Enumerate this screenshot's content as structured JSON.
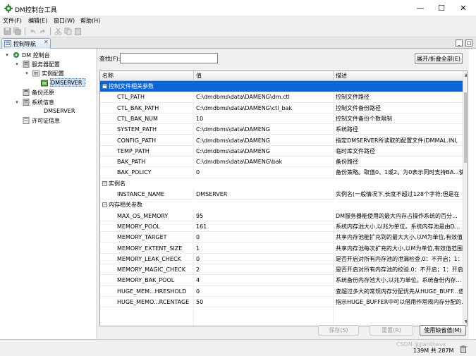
{
  "window": {
    "title": "DM控制台工具",
    "minimize": "—",
    "maximize": "☐",
    "close": "✕"
  },
  "menu": [
    "文件(F)",
    "编辑(E)",
    "窗口(W)",
    "帮助(H)"
  ],
  "tab": {
    "label": "控制导航",
    "close": "✕"
  },
  "tree": {
    "root": "DM 控制台",
    "server_config": "服务器配置",
    "instance_config": "实例配置",
    "dmserver_1": "DMSERVER",
    "backup": "备份还原",
    "sysinfo": "系统信息",
    "dmserver_2": "DMSERVER",
    "license": "许可证信息"
  },
  "search": {
    "label": "查找(F):",
    "value": ""
  },
  "expand_all": "展开/折叠全部(E)",
  "grid": {
    "headers": {
      "name": "名称",
      "value": "值",
      "desc": "描述"
    },
    "groups": [
      {
        "title": "控制文件相关参数",
        "expander": "−",
        "rows": [
          {
            "name": "CTL_PATH",
            "value": "C:\\dmdbms\\data\\DAMENG\\dm.ctl",
            "desc": "控制文件路径"
          },
          {
            "name": "CTL_BAK_PATH",
            "value": "C:\\dmdbms\\data\\DAMENG\\ctl_bak",
            "desc": "控制文件备份路径"
          },
          {
            "name": "CTL_BAK_NUM",
            "value": "10",
            "desc": "控制文件备份个数限制"
          },
          {
            "name": "SYSTEM_PATH",
            "value": "C:\\dmdbms\\data\\DAMENG",
            "desc": "系统路径"
          },
          {
            "name": "CONFIG_PATH",
            "value": "C:\\dmdbms\\data\\DAMENG",
            "desc": "指定DMSERVER所读取的配置文件(DMMAL.INI,"
          },
          {
            "name": "TEMP_PATH",
            "value": "C:\\dmdbms\\data\\DAMENG",
            "desc": "临时库文件路径"
          },
          {
            "name": "BAK_PATH",
            "value": "C:\\dmdbms\\data\\DAMENG\\bak",
            "desc": "备份路径"
          },
          {
            "name": "BAK_POLICY",
            "value": "0",
            "desc": "备份策略。取值0、1或2。为0表示同时支持BA...使"
          }
        ]
      },
      {
        "title": "实例名",
        "expander": "−",
        "rows": [
          {
            "name": "INSTANCE_NAME",
            "value": "DMSERVER",
            "desc": "实例名(一般情况下,长度不超过128个字符;但是在"
          }
        ]
      },
      {
        "title": "内存相关参数",
        "expander": "−",
        "rows": [
          {
            "name": "MAX_OS_MEMORY",
            "value": "95",
            "desc": "DM服务器能使用的最大内存占操作系统的百分..."
          },
          {
            "name": "MEMORY_POOL",
            "value": "161",
            "desc": "系统内存池大小,以兆为单位。系统内存池是由D..."
          },
          {
            "name": "MEMORY_TARGET",
            "value": "0",
            "desc": "共享内存池能扩充到的最大大小,以M为单位,有效值"
          },
          {
            "name": "MEMORY_EXTENT_SIZE",
            "value": "1",
            "desc": "共享内存池每次扩充的大小,以M为单位,有效值范围"
          },
          {
            "name": "MEMORY_LEAK_CHECK",
            "value": "0",
            "desc": "是否开启对所有内存池的泄漏检查,0：不开启；1：开"
          },
          {
            "name": "MEMORY_MAGIC_CHECK",
            "value": "2",
            "desc": "是否开启对所有内存池的校验,0：不开启；1：开启"
          },
          {
            "name": "MEMORY_BAK_POOL",
            "value": "4",
            "desc": "系统备份内存池大小,以兆为单位。系统备份内存..."
          },
          {
            "name": "HUGE_MEM...HRESHOLD",
            "value": "0",
            "desc": "查超过多大的常规内存分配优先从HUGE_BUFF...值"
          },
          {
            "name": "HUGE_MEMO...RCENTAGE",
            "value": "50",
            "desc": "指示HUGE_BUFFER中可以借用作常规内存分配的..."
          }
        ]
      }
    ]
  },
  "buttons": {
    "save": "保存(S)",
    "reset": "重置(R)",
    "default": "使用缺省值(M)"
  },
  "status": {
    "memory": "139M 共 287M",
    "watermark": "CSDN @jianthevx"
  }
}
